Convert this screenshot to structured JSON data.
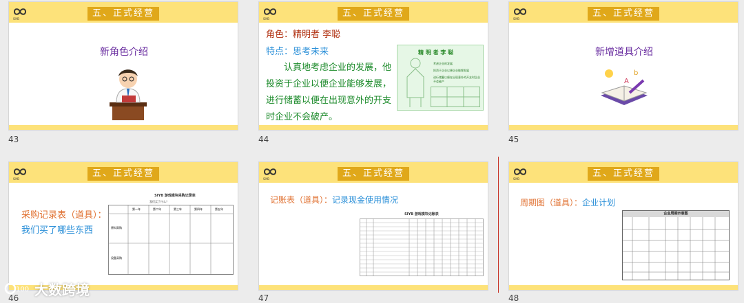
{
  "banner": "五、正式经营",
  "slides": [
    {
      "number": "43",
      "title": "新角色介绍"
    },
    {
      "number": "44",
      "role": "角色：精明者 李聪",
      "trait": "特点：思考未来",
      "para": "认真地考虑企业的发展，他投资于企业以便企业能够发展，进行储蓄以便在出现意外的开支时企业不会破产。",
      "card": {
        "title": "精 明 者 李 聪",
        "bullets": [
          "考虑企业的发展",
          "投资于企业以便企业能够发展",
          "进行储蓄以便在出现意外的开支时企业不会破产"
        ]
      }
    },
    {
      "number": "45",
      "title": "新增道具介绍"
    },
    {
      "number": "46",
      "heading": "采购记录表（道具）：",
      "sub": "我们买了哪些东西",
      "table_title": "SIYB 游戏模块采购记录表",
      "table_note": "我们买了什么？",
      "cols": [
        "第一年",
        "第二年",
        "第三年",
        "第四年",
        "第五年"
      ],
      "rows": [
        "原料采购",
        "设备采购"
      ]
    },
    {
      "number": "47",
      "heading": "记账表（道具）：",
      "sub": "记录现金使用情况",
      "table_title": "SIYB 游戏模块记账表"
    },
    {
      "number": "48",
      "heading": "周期图（道具）：",
      "sub": "企业计划",
      "table_title": "企业周期示意图"
    }
  ],
  "watermark": "大数跨境"
}
